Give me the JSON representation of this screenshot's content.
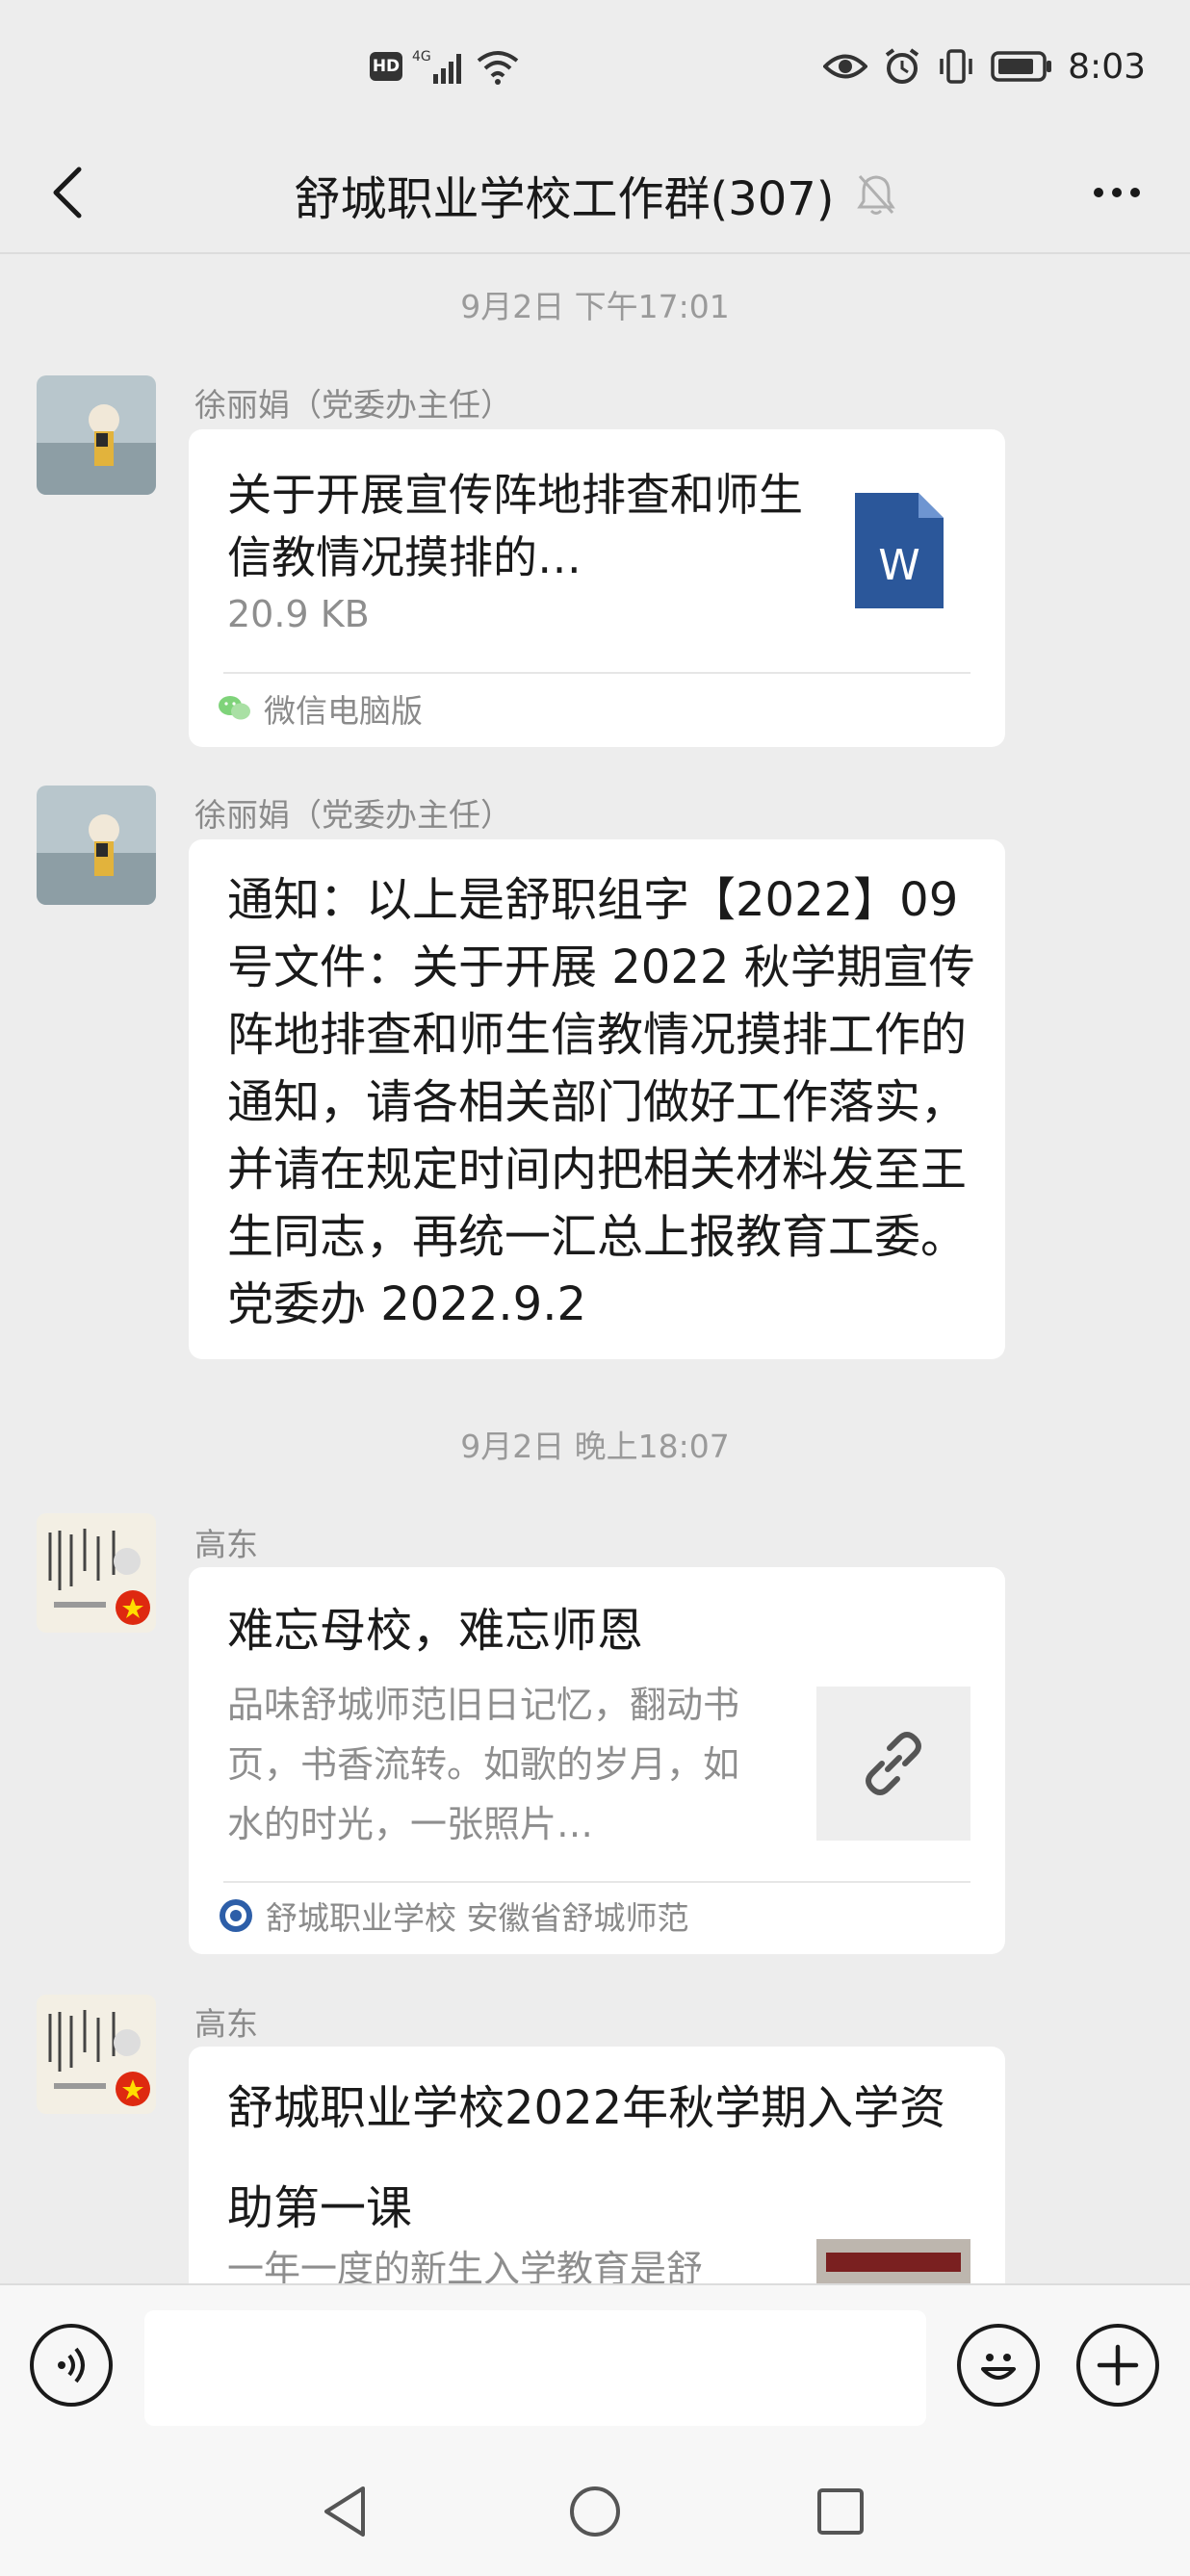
{
  "status_bar": {
    "hd": "HD",
    "network": "4G",
    "time": "8:03"
  },
  "header": {
    "title": "舒城职业学校工作群(307)"
  },
  "messages": [
    {
      "type": "timestamp",
      "text": "9月2日 下午17:01"
    },
    {
      "type": "file",
      "sender": "徐丽娟（党委办主任）",
      "file_title": "关于开展宣传阵地排查和师生信教情况摸排的…",
      "file_size": "20.9 KB",
      "file_icon_letter": "W",
      "source": "微信电脑版"
    },
    {
      "type": "text",
      "sender": "徐丽娟（党委办主任）",
      "text": "通知：以上是舒职组字【2022】09 号文件：关于开展 2022 秋学期宣传阵地排查和师生信教情况摸排工作的通知，请各相关部门做好工作落实，并请在规定时间内把相关材料发至王生同志，再统一汇总上报教育工委。党委办  2022.9.2"
    },
    {
      "type": "timestamp",
      "text": "9月2日 晚上18:07"
    },
    {
      "type": "link",
      "sender": "高东",
      "title": "难忘母校，难忘师恩",
      "desc": "品味舒城师范旧日记忆，翻动书页，书香流转。如歌的岁月，如水的时光，一张照片…",
      "source": "舒城职业学校 安徽省舒城师范"
    },
    {
      "type": "link",
      "sender": "高东",
      "title": "舒城职业学校2022年秋学期入学资助第一课",
      "desc": "一年一度的新生入学教育是舒"
    }
  ],
  "input": {
    "placeholder": ""
  },
  "colors": {
    "background": "#ededed",
    "bubble": "#ffffff",
    "word_icon": "#2b579a",
    "wechat_green": "#07c160"
  }
}
